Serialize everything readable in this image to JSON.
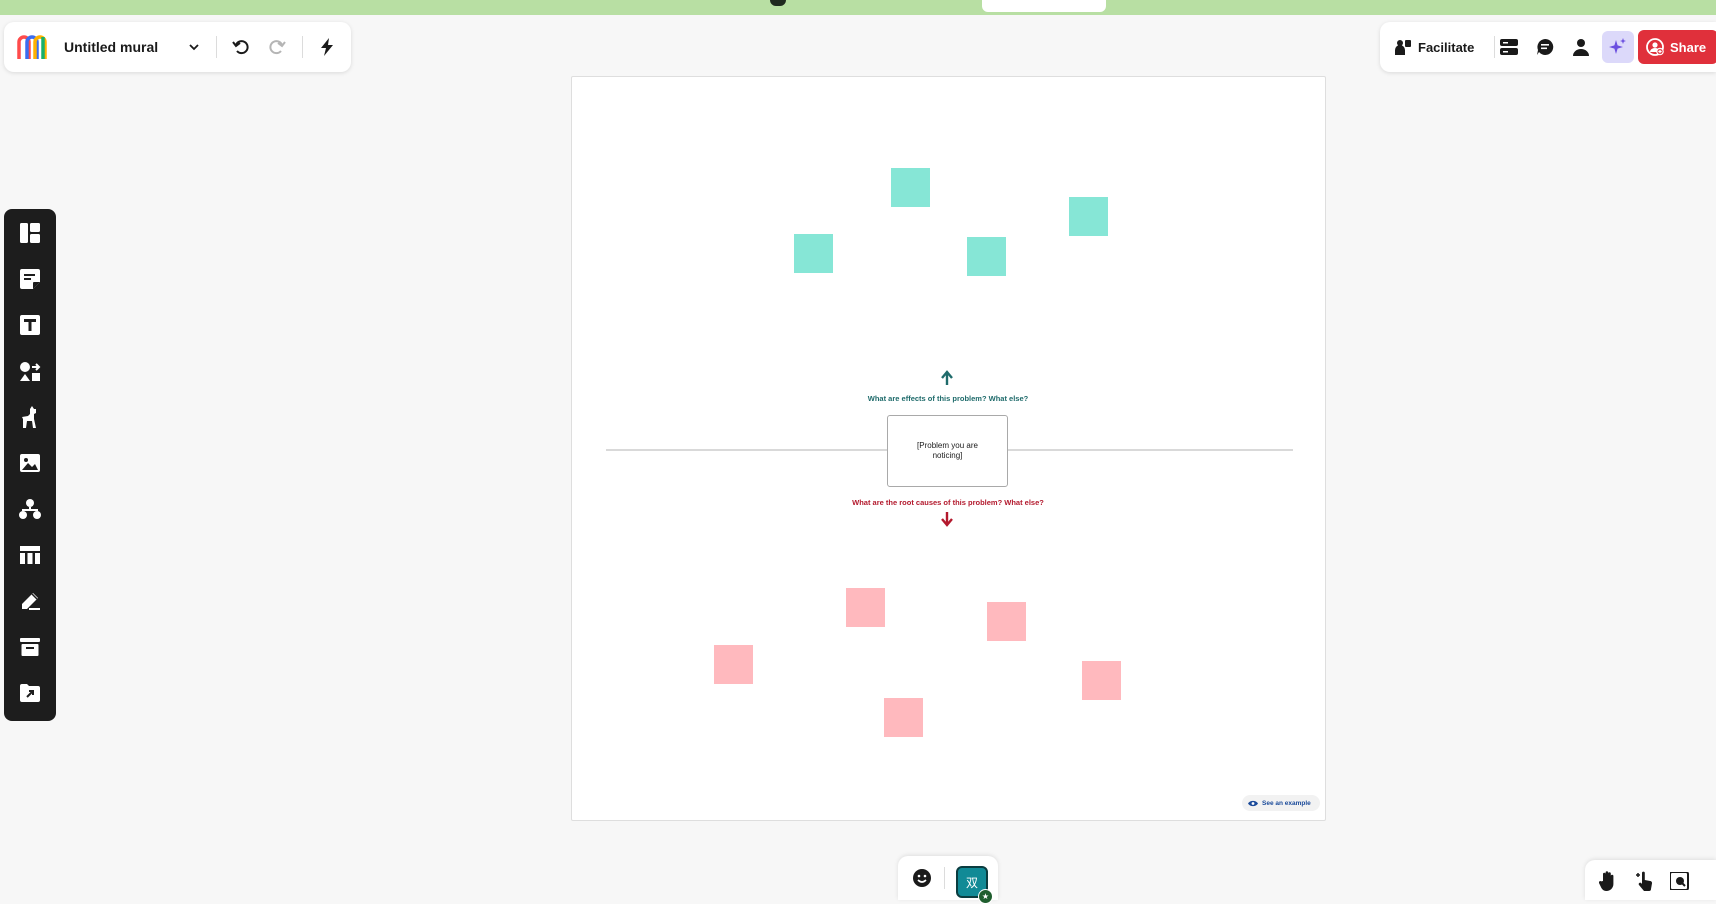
{
  "header": {
    "title": "Untitled mural",
    "icons": [
      "mural-logo-icon",
      "chevron-down-icon",
      "undo-icon",
      "redo-icon",
      "lightning-icon"
    ]
  },
  "toolbar_right": {
    "facilitate_label": "Facilitate",
    "share_label": "Share",
    "icons": [
      "outline-icon",
      "comment-icon",
      "person-icon",
      "ai-sparkle-icon"
    ],
    "share_color": "#e0303b"
  },
  "sidebar": {
    "items": [
      "templates-icon",
      "sticky-note-icon",
      "text-icon",
      "shapes-connectors-icon",
      "llama-icon",
      "image-icon",
      "diagram-icon",
      "table-icon",
      "pen-icon",
      "archive-icon",
      "upload-icon"
    ]
  },
  "canvas": {
    "effects_question": "What are effects of this problem? What else?",
    "problem_text": "[Problem you are noticing]",
    "causes_question": "What are the root causes of this problem? What else?",
    "see_example_label": "See an example",
    "colors": {
      "effects": "#1f6b6b",
      "causes": "#b3192d",
      "teal_sticky": "#86e6d6",
      "pink_sticky": "#ffb9be"
    }
  },
  "bottom": {
    "avatar_initial": "双",
    "icons": [
      "emoji-icon",
      "hand-icon",
      "cursor-hand-icon",
      "map-icon"
    ]
  }
}
